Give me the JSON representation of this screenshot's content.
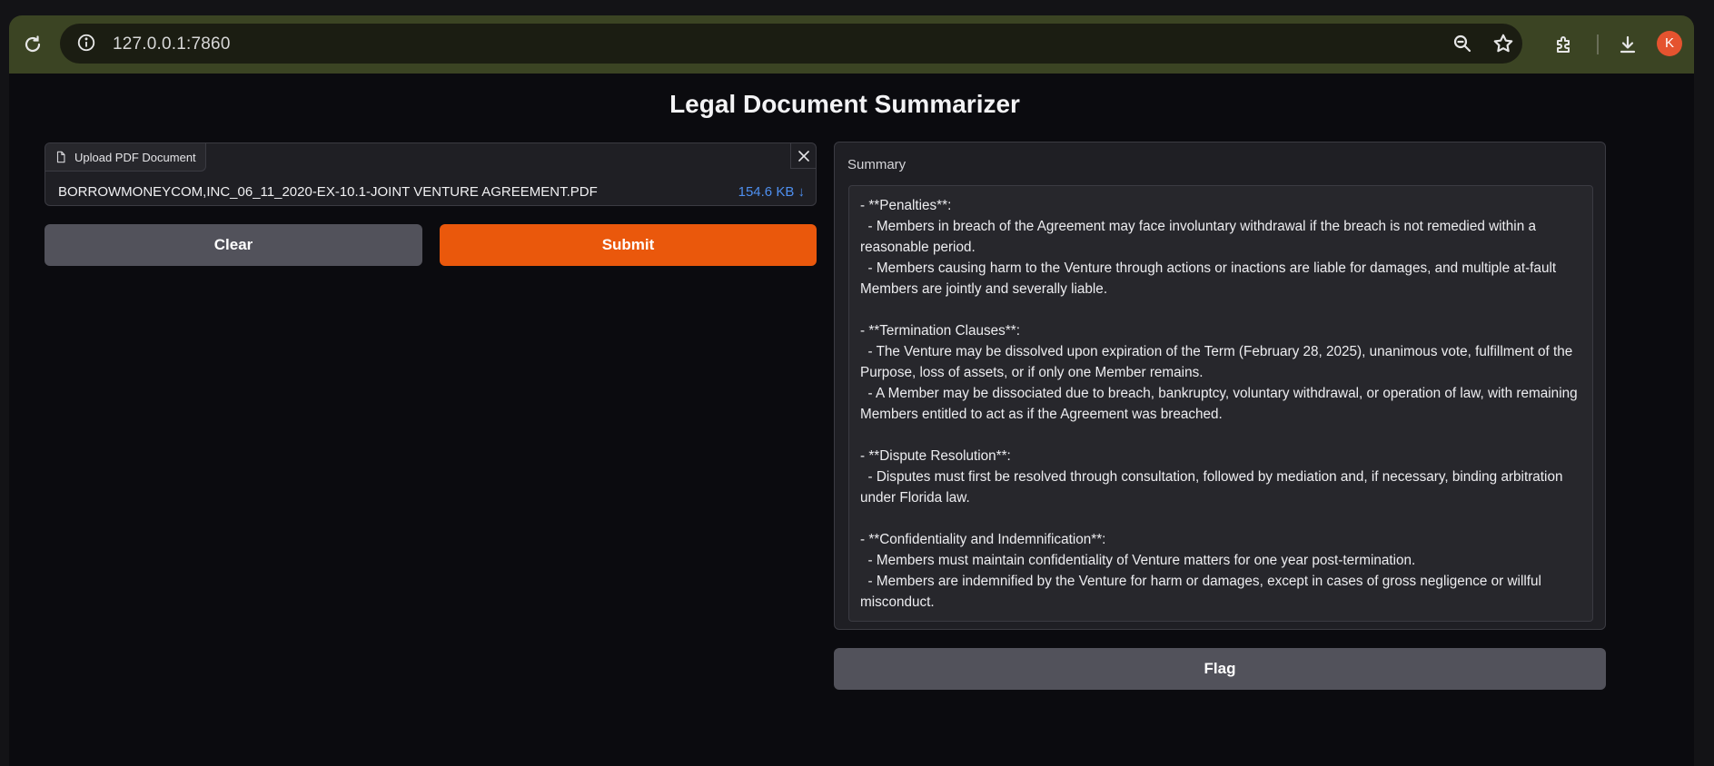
{
  "browser": {
    "url": "127.0.0.1:7860",
    "profile_initial": "K",
    "icons": [
      "reload-icon",
      "site-info-icon",
      "zoom-icon",
      "bookmark-star-icon",
      "extensions-icon",
      "download-icon"
    ]
  },
  "app": {
    "title": "Legal Document Summarizer",
    "upload": {
      "label": "Upload PDF Document",
      "file_name": "BORROWMONEYCOM,INC_06_11_2020-EX-10.1-JOINT VENTURE AGREEMENT.PDF",
      "file_size": "154.6 KB ↓"
    },
    "buttons": {
      "clear": "Clear",
      "submit": "Submit",
      "flag": "Flag"
    },
    "summary": {
      "label": "Summary",
      "text": "- **Penalties**:\n  - Members in breach of the Agreement may face involuntary withdrawal if the breach is not remedied within a reasonable period.\n  - Members causing harm to the Venture through actions or inactions are liable for damages, and multiple at-fault Members are jointly and severally liable.\n\n- **Termination Clauses**:\n  - The Venture may be dissolved upon expiration of the Term (February 28, 2025), unanimous vote, fulfillment of the Purpose, loss of assets, or if only one Member remains.\n  - A Member may be dissociated due to breach, bankruptcy, voluntary withdrawal, or operation of law, with remaining Members entitled to act as if the Agreement was breached.\n\n- **Dispute Resolution**:\n  - Disputes must first be resolved through consultation, followed by mediation and, if necessary, binding arbitration under Florida law.\n\n- **Confidentiality and Indemnification**:\n  - Members must maintain confidentiality of Venture matters for one year post-termination.\n  - Members are indemnified by the Venture for harm or damages, except in cases of gross negligence or willful misconduct."
    }
  },
  "colors": {
    "accent_submit": "#ea580c",
    "secondary_button": "#52525b",
    "file_size_link": "#4e8fef",
    "profile_avatar": "#e5532f",
    "toolbar": "#3b4423"
  }
}
